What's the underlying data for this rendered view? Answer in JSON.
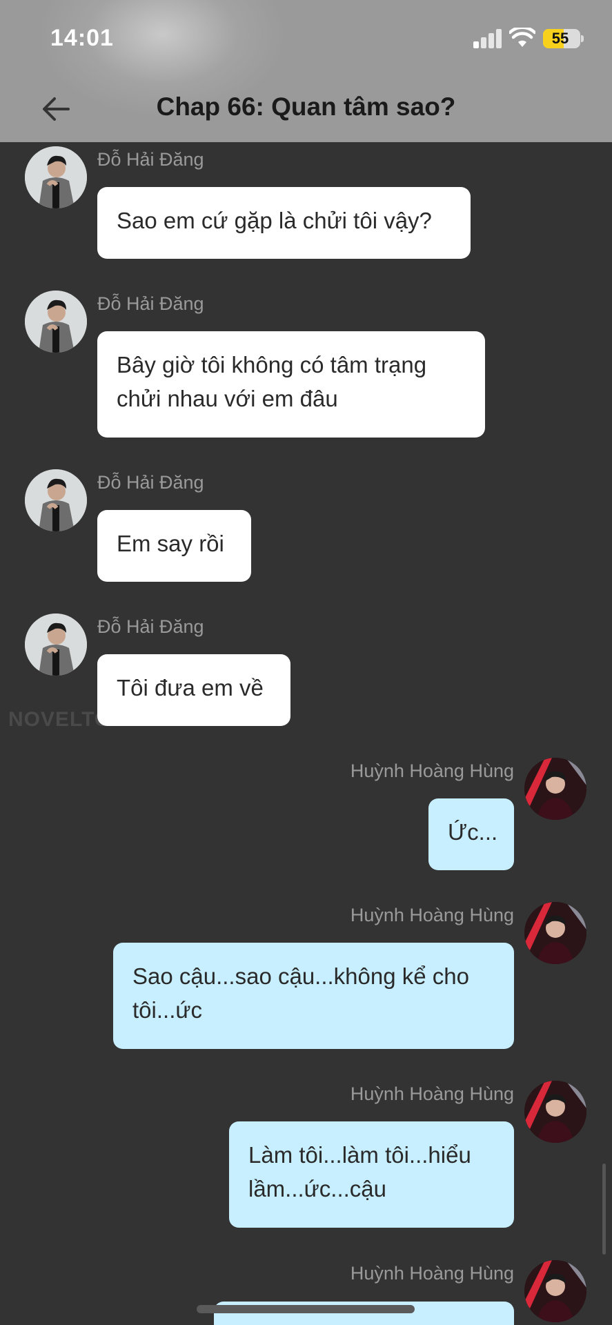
{
  "status_bar": {
    "time": "14:01",
    "battery": "55",
    "icons": [
      "cellular-signal-icon",
      "wifi-icon",
      "battery-icon"
    ]
  },
  "header": {
    "title": "Chap 66: Quan tâm sao?",
    "back_icon": "arrow-left-icon"
  },
  "watermark": "NOVELTOON",
  "messages": [
    {
      "side": "left",
      "sender": "Đỗ Hải Đăng",
      "text": "Sao em cứ gặp là chửi tôi vậy?"
    },
    {
      "side": "left",
      "sender": "Đỗ Hải Đăng",
      "text_lines": [
        "Bây giờ tôi không có tâm trạng",
        "chửi nhau với em đâu"
      ]
    },
    {
      "side": "left",
      "sender": "Đỗ Hải Đăng",
      "text": "Em say rồi"
    },
    {
      "side": "left",
      "sender": "Đỗ Hải Đăng",
      "text": "Tôi đưa em về"
    },
    {
      "side": "right",
      "sender": "Huỳnh Hoàng Hùng",
      "text": "Ức..."
    },
    {
      "side": "right",
      "sender": "Huỳnh Hoàng Hùng",
      "text_lines": [
        "Sao cậu...sao cậu...không kể cho",
        "tôi...ức"
      ]
    },
    {
      "side": "right",
      "sender": "Huỳnh Hoàng Hùng",
      "text_lines": [
        "Làm tôi...làm tôi...hiểu",
        "lầm...ức...cậu"
      ]
    },
    {
      "side": "right",
      "sender": "Huỳnh Hoàng Hùng",
      "text": ""
    }
  ],
  "colors": {
    "background": "#333333",
    "left_bubble": "#ffffff",
    "right_bubble": "#c8efff",
    "sender_name": "#9a9a9a"
  }
}
